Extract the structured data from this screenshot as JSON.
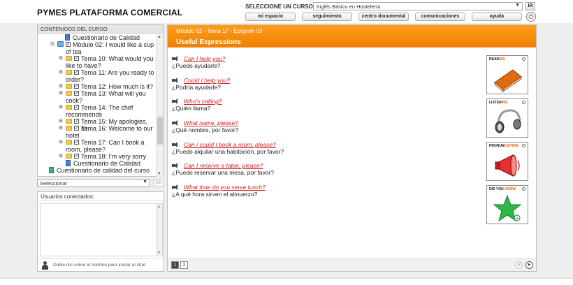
{
  "header": {
    "brand": "PYMES PLATAFORMA COMERCIAL",
    "course_label": "SELECCIONE UN CURSO:",
    "course_value": "Inglés Básico en Hostelería",
    "ir_label": "IR",
    "nav": [
      "mi espacio",
      "seguimiento",
      "centro documental",
      "comunicaciones",
      "ayuda"
    ]
  },
  "sidebar": {
    "title": "CONTENIDOS DEL CURSO",
    "tree": [
      {
        "label": "Cuestionario de Calidad",
        "kind": "doc"
      },
      {
        "label": "Módulo 02: I would like a cup",
        "kind": "module"
      },
      {
        "label": "of tea",
        "kind": "cont"
      },
      {
        "label": "Tema 10: What would you",
        "kind": "tema"
      },
      {
        "label": "like to have?",
        "kind": "cont"
      },
      {
        "label": "Tema 11: Are you ready to",
        "kind": "tema"
      },
      {
        "label": "order?",
        "kind": "cont"
      },
      {
        "label": "Tema 12: How much is it?",
        "kind": "tema"
      },
      {
        "label": "Tema 13: What will you",
        "kind": "tema"
      },
      {
        "label": "cook?",
        "kind": "cont"
      },
      {
        "label": "Tema 14: The chef",
        "kind": "tema"
      },
      {
        "label": "recommends",
        "kind": "cont"
      },
      {
        "label": "Tema 15: My apologies, sir.",
        "kind": "tema"
      },
      {
        "label": "Tema 16: Welcome to our",
        "kind": "tema"
      },
      {
        "label": "hotel",
        "kind": "cont"
      },
      {
        "label": "Tema 17: Can I book a",
        "kind": "tema"
      },
      {
        "label": "room, please?",
        "kind": "cont"
      },
      {
        "label": "Tema 18: I'm very sorry",
        "kind": "tema"
      },
      {
        "label": "Cuestionario de Calidad",
        "kind": "doc2"
      },
      {
        "label": "Cuestionario de calidad del curso",
        "kind": "doc3"
      }
    ],
    "select_value": "Seleccionar",
    "ok_label": "OK"
  },
  "users": {
    "title": "Usuarios conectados:",
    "hint": "Doble clic sobre el nombre para invitar al chat"
  },
  "main": {
    "crumb": "Módulo 02 - Tema 17 - Epígrafe 03",
    "title": "Useful Expressions",
    "expressions": [
      {
        "en": "Can I help you?",
        "es": "¿Puedo ayudarle?"
      },
      {
        "en": "Could I help you?",
        "es": "¿Podría ayudarle?"
      },
      {
        "en": "Who's calling?",
        "es": "¿Quién llama?"
      },
      {
        "en": "What name, please?",
        "es": "¿Qué nombre, por favor?"
      },
      {
        "en": "Can / could I book a room, please?",
        "es": "¿Puedo alquilar una habitación, por favor?"
      },
      {
        "en": "Can I reserve a table, please?",
        "es": "¿Puedo reservar una mesa, por favor?"
      },
      {
        "en": "What time do you serve lunch?",
        "es": "¿A qué hora sirven el almuerzo?"
      }
    ],
    "skills": [
      {
        "base": "READ",
        "accent": "ING"
      },
      {
        "base": "LISTEN",
        "accent": "ING"
      },
      {
        "base": "PRONUN",
        "accent": "CIATION"
      },
      {
        "base": "DID YOU ",
        "accent": "KNOW"
      }
    ],
    "pages": [
      "1",
      "2"
    ]
  },
  "colors": {
    "accent": "#f08a00",
    "link": "#d42020"
  }
}
